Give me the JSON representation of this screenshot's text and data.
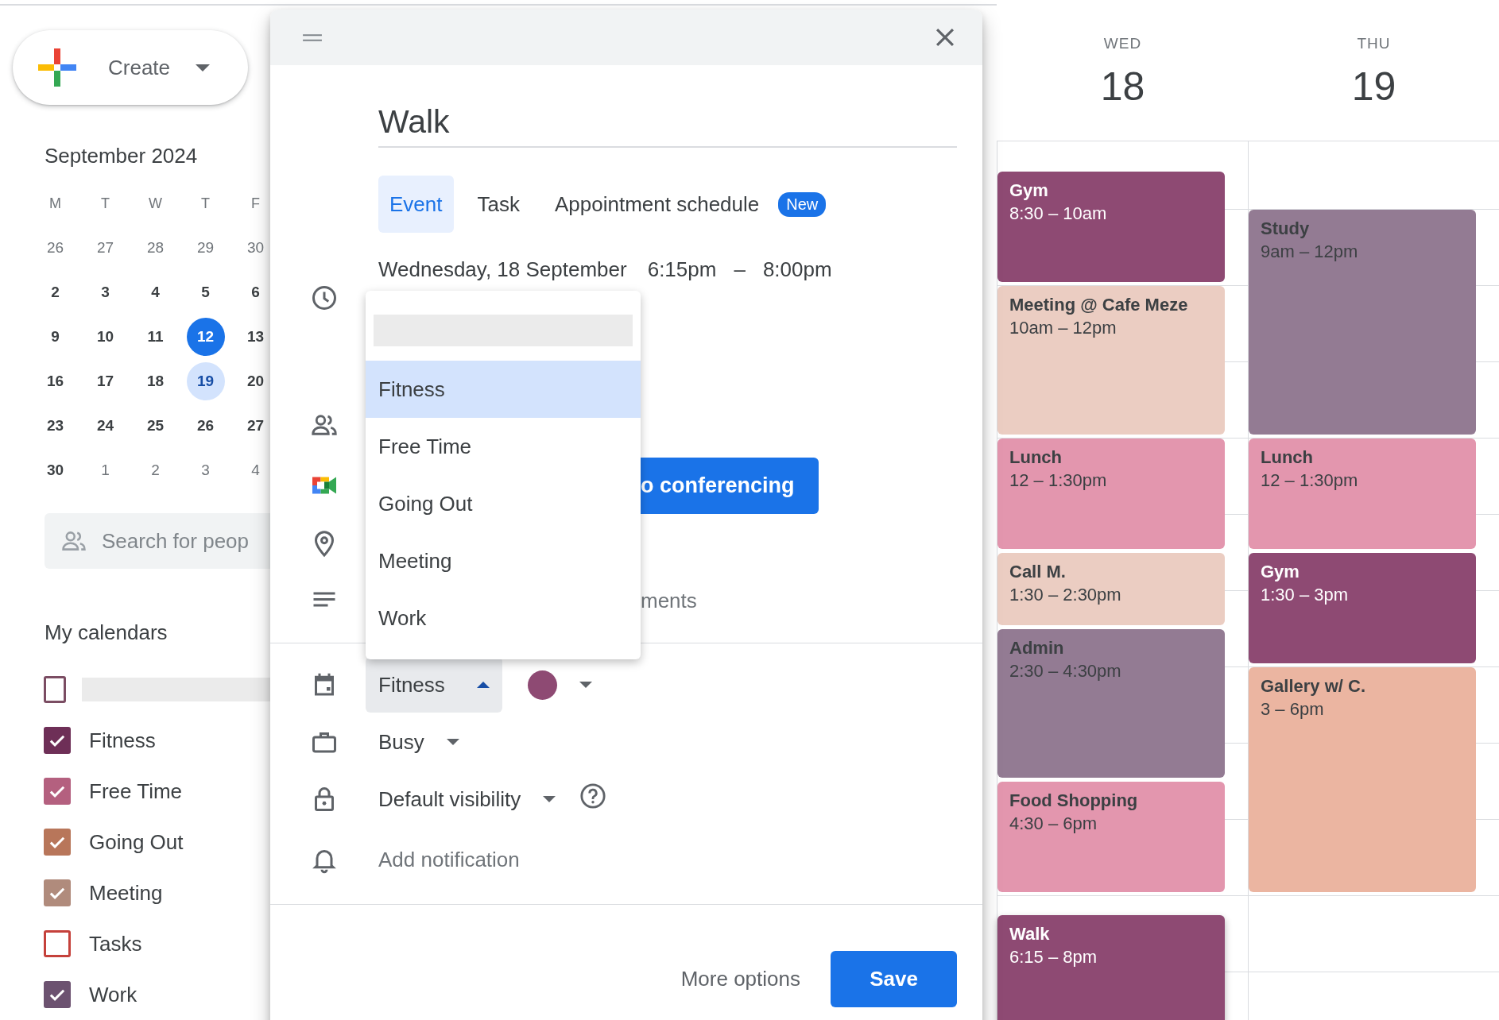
{
  "sidebar": {
    "create_button": "Create",
    "mini_calendar": {
      "title": "September 2024",
      "weekdays": [
        "M",
        "T",
        "W",
        "T",
        "F"
      ],
      "weeks": [
        [
          {
            "d": "26",
            "muted": true,
            "today": false,
            "selected": false
          },
          {
            "d": "27",
            "muted": true,
            "today": false,
            "selected": false
          },
          {
            "d": "28",
            "muted": true,
            "today": false,
            "selected": false
          },
          {
            "d": "29",
            "muted": true,
            "today": false,
            "selected": false
          },
          {
            "d": "30",
            "muted": true,
            "today": false,
            "selected": false
          }
        ],
        [
          {
            "d": "2",
            "muted": false,
            "today": false,
            "selected": false
          },
          {
            "d": "3",
            "muted": false,
            "today": false,
            "selected": false
          },
          {
            "d": "4",
            "muted": false,
            "today": false,
            "selected": false
          },
          {
            "d": "5",
            "muted": false,
            "today": false,
            "selected": false
          },
          {
            "d": "6",
            "muted": false,
            "today": false,
            "selected": false
          }
        ],
        [
          {
            "d": "9",
            "muted": false,
            "today": false,
            "selected": false
          },
          {
            "d": "10",
            "muted": false,
            "today": false,
            "selected": false
          },
          {
            "d": "11",
            "muted": false,
            "today": false,
            "selected": false
          },
          {
            "d": "12",
            "muted": false,
            "today": true,
            "selected": false
          },
          {
            "d": "13",
            "muted": false,
            "today": false,
            "selected": false
          }
        ],
        [
          {
            "d": "16",
            "muted": false,
            "today": false,
            "selected": false
          },
          {
            "d": "17",
            "muted": false,
            "today": false,
            "selected": false
          },
          {
            "d": "18",
            "muted": false,
            "today": false,
            "selected": false
          },
          {
            "d": "19",
            "muted": false,
            "today": false,
            "selected": true
          },
          {
            "d": "20",
            "muted": false,
            "today": false,
            "selected": false
          }
        ],
        [
          {
            "d": "23",
            "muted": false,
            "today": false,
            "selected": false
          },
          {
            "d": "24",
            "muted": false,
            "today": false,
            "selected": false
          },
          {
            "d": "25",
            "muted": false,
            "today": false,
            "selected": false
          },
          {
            "d": "26",
            "muted": false,
            "today": false,
            "selected": false
          },
          {
            "d": "27",
            "muted": false,
            "today": false,
            "selected": false
          }
        ],
        [
          {
            "d": "30",
            "muted": false,
            "today": false,
            "selected": false
          },
          {
            "d": "1",
            "muted": true,
            "today": false,
            "selected": false
          },
          {
            "d": "2",
            "muted": true,
            "today": false,
            "selected": false
          },
          {
            "d": "3",
            "muted": true,
            "today": false,
            "selected": false
          },
          {
            "d": "4",
            "muted": true,
            "today": false,
            "selected": false
          }
        ]
      ]
    },
    "search": {
      "placeholder": "Search for peop"
    },
    "my_calendars": {
      "title": "My calendars",
      "items": [
        {
          "redacted": true,
          "checked": false,
          "color": "#7b4d63"
        },
        {
          "label": "Fitness",
          "checked": true,
          "color": "#6e2f57"
        },
        {
          "label": "Free Time",
          "checked": true,
          "color": "#b4607f"
        },
        {
          "label": "Going Out",
          "checked": true,
          "color": "#b8765a"
        },
        {
          "label": "Meeting",
          "checked": true,
          "color": "#b08b7c"
        },
        {
          "label": "Tasks",
          "checked": false,
          "color": "#c5413b"
        },
        {
          "label": "Work",
          "checked": true,
          "color": "#6c5270"
        }
      ]
    }
  },
  "week_view": {
    "days": [
      {
        "weekday": "WED",
        "date": "18",
        "events": [
          {
            "title": "Gym",
            "time": "8:30 – 10am",
            "color": "#8e4a73"
          },
          {
            "title": "Meeting @ Cafe Meze",
            "time": "10am – 12pm",
            "color": "#ebcdc2"
          },
          {
            "title": "Lunch",
            "time": "12 – 1:30pm",
            "color": "#e396ae"
          },
          {
            "title": "Call M.",
            "time": "1:30 – 2:30pm",
            "color": "#ebcdc2"
          },
          {
            "title": "Admin",
            "time": "2:30 – 4:30pm",
            "color": "#937b93"
          },
          {
            "title": "Food Shopping",
            "time": "4:30 – 6pm",
            "color": "#e396ae"
          },
          {
            "title": "Walk",
            "time": "6:15 – 8pm",
            "color": "#8e4a73"
          }
        ]
      },
      {
        "weekday": "THU",
        "date": "19",
        "events": [
          {
            "title": "Study",
            "time": "9am – 12pm",
            "color": "#937b93"
          },
          {
            "title": "Lunch",
            "time": "12 – 1:30pm",
            "color": "#e396ae"
          },
          {
            "title": "Gym",
            "time": "1:30 – 3pm",
            "color": "#8e4a73"
          },
          {
            "title": "Gallery w/ C.",
            "time": "3 – 6pm",
            "color": "#ebb5a1"
          }
        ]
      }
    ]
  },
  "event_dialog": {
    "title": "Walk",
    "tabs": [
      {
        "label": "Event",
        "selected": true
      },
      {
        "label": "Task",
        "selected": false
      },
      {
        "label": "Appointment schedule",
        "selected": false,
        "badge": "New"
      }
    ],
    "date": "Wednesday, 18 September",
    "start_time": "6:15pm",
    "time_separator": "–",
    "end_time": "8:00pm",
    "conferencing_button": "o conferencing",
    "description_placeholder": "ments",
    "calendar_select": {
      "value": "Fitness",
      "expanded": true
    },
    "color_picker": {
      "color": "#8e4a73"
    },
    "availability": "Busy",
    "visibility": "Default visibility",
    "notification": "Add notification",
    "more_options": "More options",
    "save": "Save"
  },
  "calendar_menu": {
    "items": [
      {
        "redacted": true,
        "selected": false
      },
      {
        "label": "Fitness",
        "selected": true
      },
      {
        "label": "Free Time",
        "selected": false
      },
      {
        "label": "Going Out",
        "selected": false
      },
      {
        "label": "Meeting",
        "selected": false
      },
      {
        "label": "Work",
        "selected": false
      }
    ]
  }
}
